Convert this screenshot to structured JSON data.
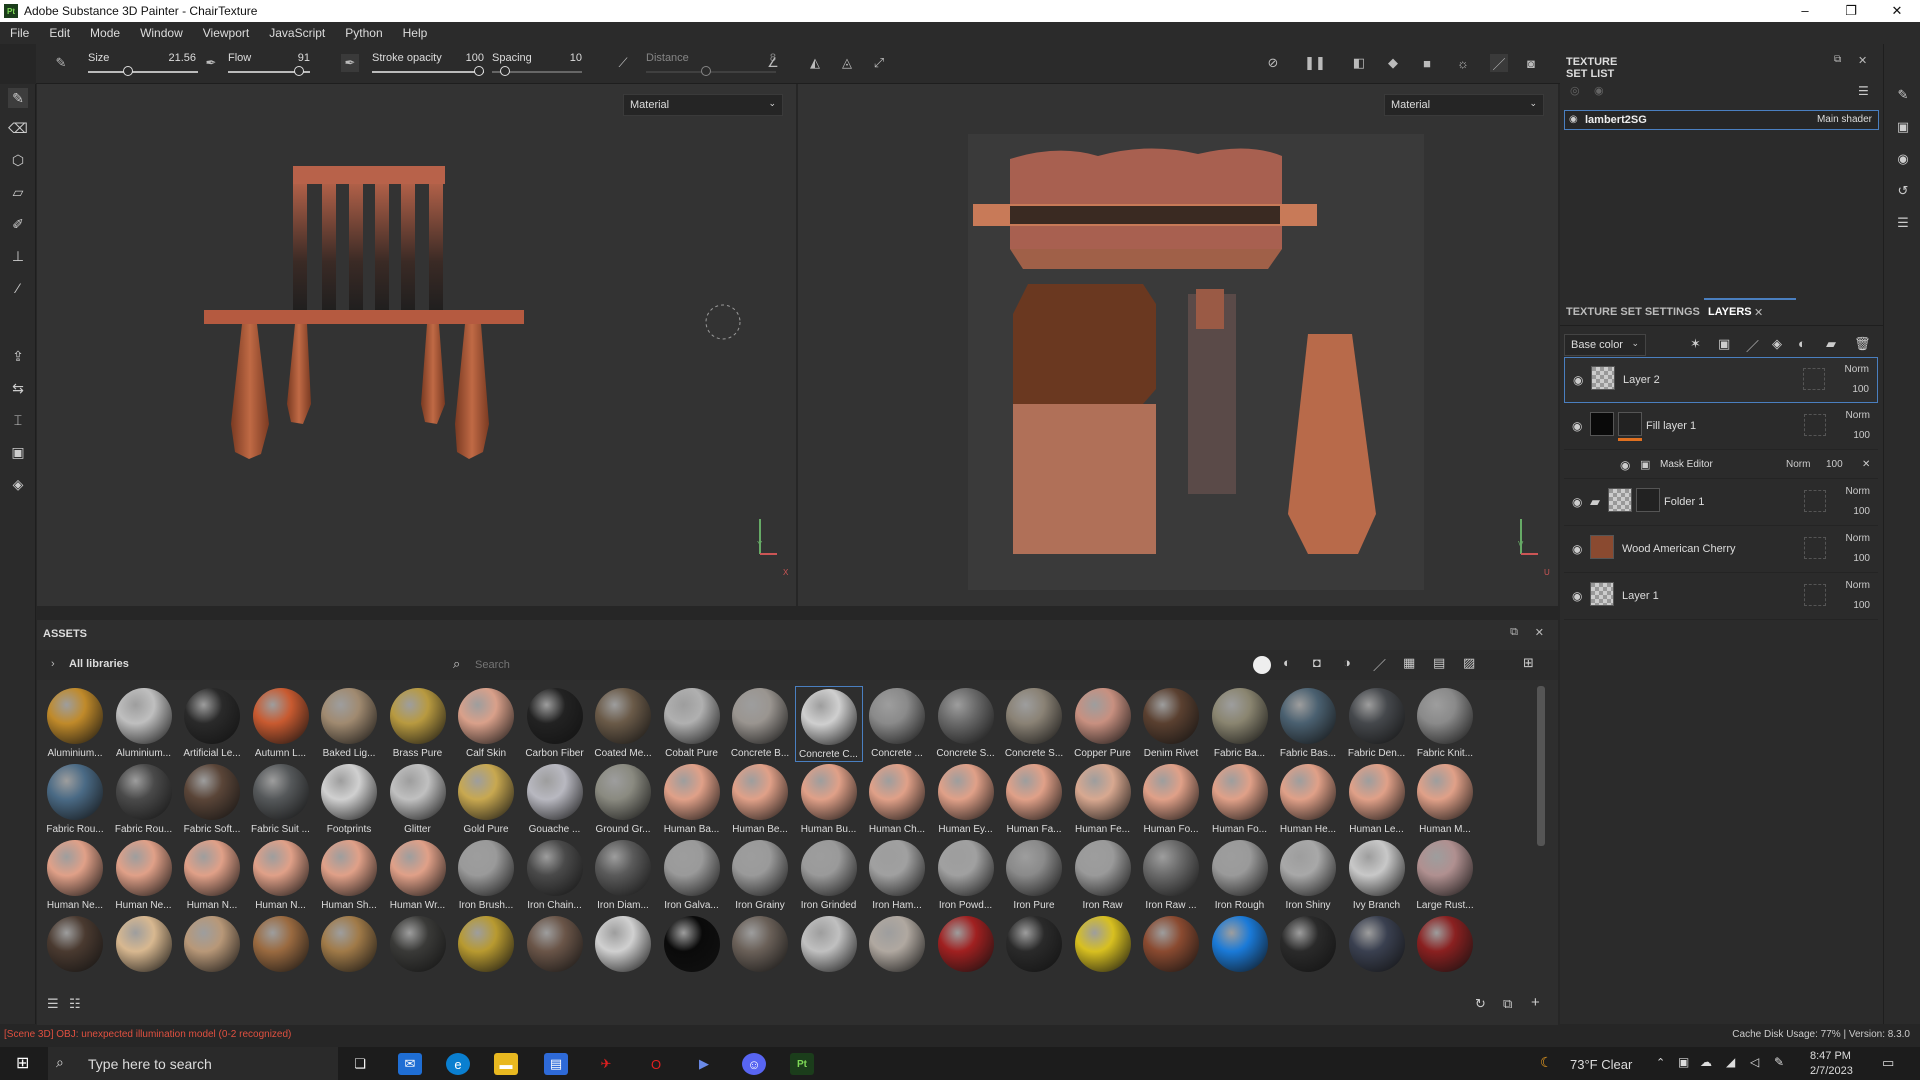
{
  "window": {
    "title": "Adobe Substance 3D Painter - ChairTexture",
    "app_badge": "Pt",
    "min": "–",
    "max": "❐",
    "close": "✕"
  },
  "menu": [
    "File",
    "Edit",
    "Mode",
    "Window",
    "Viewport",
    "JavaScript",
    "Python",
    "Help"
  ],
  "toolbar": {
    "size": {
      "label": "Size",
      "value": "21.56",
      "level": 0.35
    },
    "flow": {
      "label": "Flow",
      "value": "91",
      "level": 0.91
    },
    "stroke_opacity": {
      "label": "Stroke opacity",
      "value": "100",
      "level": 1.0
    },
    "spacing": {
      "label": "Spacing",
      "value": "10",
      "level": 0.1
    },
    "distance": {
      "label": "Distance",
      "value": "8"
    }
  },
  "viewport3d": {
    "dropdown": "Material",
    "axis_y": "Y",
    "axis_x": "X"
  },
  "viewport2d": {
    "dropdown": "Material",
    "axis_v": "V",
    "axis_u": "U"
  },
  "texture_set_list": {
    "title": "TEXTURE SET LIST",
    "item": "lambert2SG",
    "shader": "Main shader"
  },
  "layers_panel": {
    "tab_settings": "TEXTURE SET SETTINGS",
    "tab_layers": "LAYERS",
    "channel": "Base color",
    "layers": [
      {
        "name": "Layer 2",
        "blend": "Norm",
        "opacity": "100"
      },
      {
        "name": "Fill layer 1",
        "blend": "Norm",
        "opacity": "100"
      },
      {
        "name": "Mask Editor",
        "blend": "Norm",
        "opacity": "100"
      },
      {
        "name": "Folder 1",
        "blend": "Norm",
        "opacity": "100"
      },
      {
        "name": "Wood American Cherry",
        "blend": "Norm",
        "opacity": "100"
      },
      {
        "name": "Layer 1",
        "blend": "Norm",
        "opacity": "100"
      }
    ]
  },
  "assets": {
    "title": "ASSETS",
    "library": "All libraries",
    "search_placeholder": "Search",
    "materials": [
      {
        "name": "Aluminium...",
        "color": "#c08a2a"
      },
      {
        "name": "Aluminium...",
        "color": "#bfbfbf"
      },
      {
        "name": "Artificial Le...",
        "color": "#2a2a2a"
      },
      {
        "name": "Autumn L...",
        "color": "#c85a30"
      },
      {
        "name": "Baked Lig...",
        "color": "#a08a70"
      },
      {
        "name": "Brass Pure",
        "color": "#b89a40"
      },
      {
        "name": "Calf Skin",
        "color": "#d9a08a"
      },
      {
        "name": "Carbon Fiber",
        "color": "#222222"
      },
      {
        "name": "Coated Me...",
        "color": "#6a5a48"
      },
      {
        "name": "Cobalt Pure",
        "color": "#b0b0b0"
      },
      {
        "name": "Concrete B...",
        "color": "#9a9590"
      },
      {
        "name": "Concrete C...",
        "color": "#cfcfcf"
      },
      {
        "name": "Concrete ...",
        "color": "#8a8a8a"
      },
      {
        "name": "Concrete S...",
        "color": "#6a6a6a"
      },
      {
        "name": "Concrete S...",
        "color": "#8a8275"
      },
      {
        "name": "Copper Pure",
        "color": "#c89080"
      },
      {
        "name": "Denim Rivet",
        "color": "#5a4030"
      },
      {
        "name": "Fabric Ba...",
        "color": "#8a8570"
      },
      {
        "name": "Fabric Bas...",
        "color": "#4a6070"
      },
      {
        "name": "Fabric Den...",
        "color": "#45484c"
      },
      {
        "name": "Fabric Knit...",
        "color": "#8a8a8a"
      },
      {
        "name": "Fabric Rou...",
        "color": "#4a6a85"
      },
      {
        "name": "Fabric Rou...",
        "color": "#4a4a4a"
      },
      {
        "name": "Fabric Soft...",
        "color": "#5a4538"
      },
      {
        "name": "Fabric Suit ...",
        "color": "#55585a"
      },
      {
        "name": "Footprints",
        "color": "#d0d0d0"
      },
      {
        "name": "Glitter",
        "color": "#c0c0c0"
      },
      {
        "name": "Gold Pure",
        "color": "#c8a850"
      },
      {
        "name": "Gouache ...",
        "color": "#b8b8c0"
      },
      {
        "name": "Ground Gr...",
        "color": "#8a8a80"
      },
      {
        "name": "Human Ba...",
        "color": "#e0a088"
      },
      {
        "name": "Human Be...",
        "color": "#e0a088"
      },
      {
        "name": "Human Bu...",
        "color": "#e0a088"
      },
      {
        "name": "Human Ch...",
        "color": "#e0a088"
      },
      {
        "name": "Human Ey...",
        "color": "#e0a088"
      },
      {
        "name": "Human Fa...",
        "color": "#e0a088"
      },
      {
        "name": "Human Fe...",
        "color": "#d8a890"
      },
      {
        "name": "Human Fo...",
        "color": "#e0a088"
      },
      {
        "name": "Human Fo...",
        "color": "#e0a088"
      },
      {
        "name": "Human He...",
        "color": "#e0a088"
      },
      {
        "name": "Human Le...",
        "color": "#e0a088"
      },
      {
        "name": "Human M...",
        "color": "#e0a088"
      },
      {
        "name": "Human Ne...",
        "color": "#e0a088"
      },
      {
        "name": "Human Ne...",
        "color": "#e0a088"
      },
      {
        "name": "Human N...",
        "color": "#e0a088"
      },
      {
        "name": "Human N...",
        "color": "#e0a088"
      },
      {
        "name": "Human Sh...",
        "color": "#e0a088"
      },
      {
        "name": "Human Wr...",
        "color": "#e0a088"
      },
      {
        "name": "Iron Brush...",
        "color": "#9a9a9a"
      },
      {
        "name": "Iron Chain...",
        "color": "#4a4a4a"
      },
      {
        "name": "Iron Diam...",
        "color": "#5a5a5a"
      },
      {
        "name": "Iron Galva...",
        "color": "#9a9a9a"
      },
      {
        "name": "Iron Grainy",
        "color": "#9a9a9a"
      },
      {
        "name": "Iron Grinded",
        "color": "#9a9a9a"
      },
      {
        "name": "Iron Ham...",
        "color": "#a0a0a0"
      },
      {
        "name": "Iron Powd...",
        "color": "#a0a0a0"
      },
      {
        "name": "Iron Pure",
        "color": "#8a8a8a"
      },
      {
        "name": "Iron Raw",
        "color": "#9a9a9a"
      },
      {
        "name": "Iron Raw ...",
        "color": "#6a6a6a"
      },
      {
        "name": "Iron Rough",
        "color": "#9a9a9a"
      },
      {
        "name": "Iron Shiny",
        "color": "#a8a8a8"
      },
      {
        "name": "Ivy Branch",
        "color": "#c8c8c8"
      },
      {
        "name": "Large Rust...",
        "color": "#b09090"
      }
    ],
    "row4_colors": [
      "#4a3a30",
      "#d8b890",
      "#b89878",
      "#9a6a40",
      "#a07a48",
      "#3a3a38",
      "#b89a30",
      "#6a5548",
      "#d0d0d0",
      "#0a0a0a",
      "#6a6058",
      "#c0c0c0",
      "#b0a8a0",
      "#a02020",
      "#2a2a2a",
      "#d8c020",
      "#8a4a30",
      "#1a7ad8",
      "#2a2a2a",
      "#3a4050",
      "#8a2020"
    ]
  },
  "status": {
    "error": "[Scene 3D] OBJ: unexpected illumination model (0-2 recognized)",
    "cache": "Cache Disk Usage:   77% | Version: 8.3.0"
  },
  "taskbar": {
    "search": "Type here to search",
    "weather": "73°F  Clear",
    "time": "8:47 PM",
    "date": "2/7/2023"
  }
}
